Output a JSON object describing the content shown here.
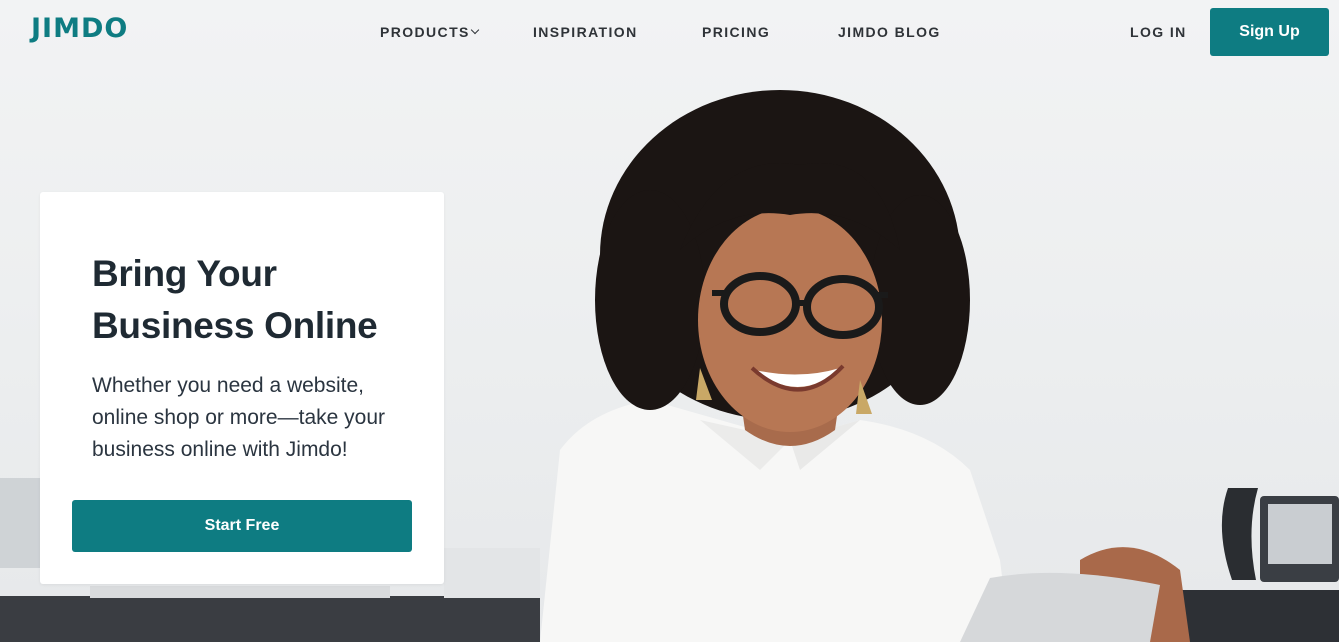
{
  "brand": {
    "logo_text": "JIMDO",
    "accent": "#0e7c82"
  },
  "nav": {
    "items": [
      {
        "label": "PRODUCTS"
      },
      {
        "label": "INSPIRATION"
      },
      {
        "label": "PRICING"
      },
      {
        "label": "JIMDO BLOG"
      }
    ],
    "login_label": "LOG IN",
    "signup_label": "Sign Up"
  },
  "hero": {
    "headline": "Bring Your Business Online",
    "subtext": "Whether you need a website, online shop or more—take your business online with Jimdo!",
    "cta_label": "Start Free"
  }
}
